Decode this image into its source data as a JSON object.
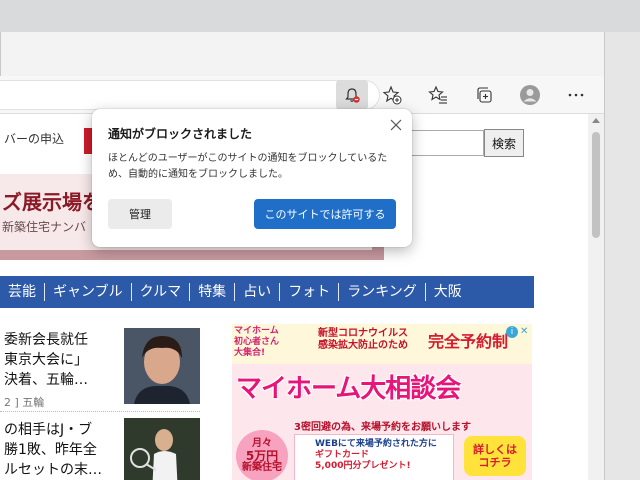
{
  "window_controls": {
    "minimize_icon": "minimize-icon",
    "maximize_icon": "maximize-icon",
    "close_icon": "close-icon"
  },
  "toolbar": {
    "notification_blocked_icon": "bell-blocked-icon",
    "add_favorite_icon": "star-plus-icon",
    "favorites_icon": "favorites-list-icon",
    "collections_icon": "collections-icon",
    "profile_icon": "avatar",
    "more_icon": "ellipsis-icon"
  },
  "page": {
    "top_link": "バーの申込",
    "search_button": "検索",
    "banner_title": "ズ展示場を",
    "banner_sub": "新築住宅ナンバ",
    "nav": [
      "芸能",
      "ギャンブル",
      "クルマ",
      "特集",
      "占い",
      "フォト",
      "ランキング",
      "大阪"
    ],
    "news": [
      {
        "line1": "委新会長就任",
        "line2": "東京大会に」",
        "line3": "決着、五輪…",
        "meta": "2 ] 五輪"
      },
      {
        "line1": "の相手はJ・ブ",
        "line2": "勝1敗、昨年全",
        "line3": "ルセットの末…",
        "meta": ""
      }
    ]
  },
  "ad": {
    "left_small": "マイホーム\n初心者さん\n大集合!",
    "top_small": "新型コロナウイルス\n感染拡大防止のため",
    "top_big": "完全予約制",
    "main": "マイホーム大相談会",
    "sub": "3密回避の為、来場予約をお願いします",
    "circle_line1": "月々",
    "circle_line2": "5万円",
    "circle_line3": "新築住宅",
    "card_line1": "WEBにて来場予約された方に",
    "card_line2": "ギフトカード",
    "card_line3": "5,000円分プレゼント!",
    "cta_line1": "詳しくは",
    "cta_line2": "コチラ"
  },
  "popup": {
    "title": "通知がブロックされました",
    "body": "ほとんどのユーザーがこのサイトの通知をブロックしているため、自動的に通知をブロックしました。",
    "manage_button": "管理",
    "allow_button": "このサイトでは許可する"
  }
}
